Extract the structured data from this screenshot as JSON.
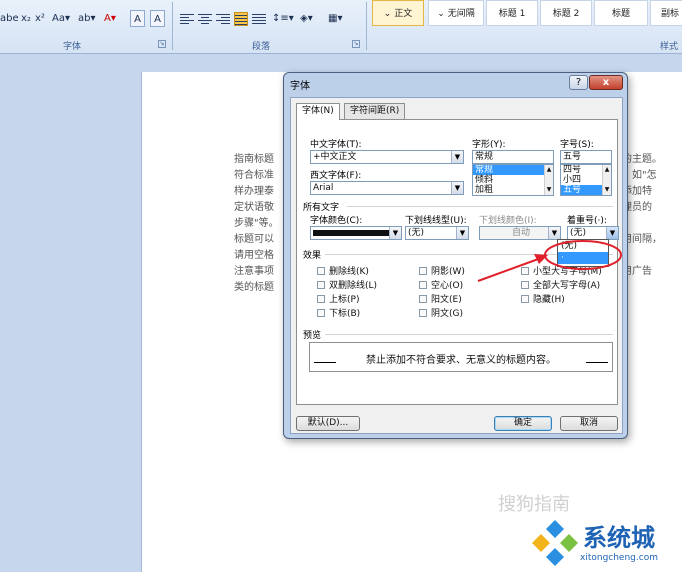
{
  "ribbon": {
    "font_group_label": "字体",
    "para_group_label": "段落",
    "style_group_label": "样式",
    "font_buttons": [
      "abe",
      "x₂",
      "x²",
      "Aa▾",
      "ab▾",
      "A▾",
      "A",
      "A"
    ],
    "styles": [
      "⌄ 正文",
      "⌄ 无间隔",
      "标题 1",
      "标题 2",
      "标题",
      "副标"
    ]
  },
  "doc_lines_left": [
    "指南标题",
    "符合标准",
    "样办理泰",
    "定状语敬",
    "步骤\"等。",
    "标题可以",
    "请用空格",
    "注意事项",
    "类的标题"
  ],
  "doc_lines_right": [
    "的主题。",
    "，如\"怎",
    "添加特",
    "理员的",
    "",
    "用间隔，",
    "",
    "用广告",
    ""
  ],
  "dialog": {
    "title": "字体",
    "help_label": "?",
    "close_label": "x",
    "tabs": [
      "字体(N)",
      "字符间距(R)"
    ],
    "chinese_font_label": "中文字体(T):",
    "chinese_font_value": "+中文正文",
    "western_font_label": "西文字体(F):",
    "western_font_value": "Arial",
    "font_style_label": "字形(Y):",
    "font_style_value": "常规",
    "font_style_options": [
      "常规",
      "倾斜",
      "加粗"
    ],
    "font_size_label": "字号(S):",
    "font_size_value": "五号",
    "font_size_options": [
      "四号",
      "小四",
      "五号"
    ],
    "all_text_label": "所有文字",
    "font_color_label": "字体颜色(C):",
    "underline_style_label": "下划线线型(U):",
    "underline_style_value": "(无)",
    "underline_color_label": "下划线颜色(I):",
    "underline_color_value": "自动",
    "emphasis_label": "着重号(·):",
    "emphasis_value": "(无)",
    "effects_label": "效果",
    "effects": [
      "删除线(K)",
      "双删除线(L)",
      "上标(P)",
      "下标(B)",
      "阴影(W)",
      "空心(O)",
      "阳文(E)",
      "阴文(G)",
      "小型大写字母(M)",
      "全部大写字母(A)",
      "隐藏(H)"
    ],
    "preview_label": "预览",
    "preview_text": "禁止添加不符合要求、无意义的标题内容。",
    "default_button": "默认(D)...",
    "ok_button": "确定",
    "cancel_button": "取消"
  },
  "emphasis_dropdown": [
    "(无)",
    "·"
  ],
  "watermark": {
    "brand": "系统城",
    "url": "xitongcheng.com",
    "faint": "搜狗指南"
  },
  "colors": {
    "ribbon": "#dbe7f6",
    "dialog_frame": "#bcd0ea",
    "selection": "#3399ff",
    "annotation": "#e0202a",
    "brand": "#1f63b5"
  }
}
